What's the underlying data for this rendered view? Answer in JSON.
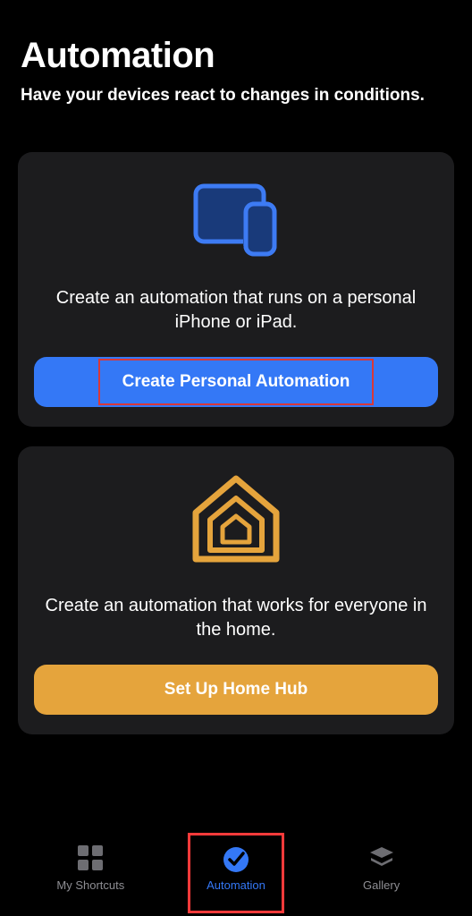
{
  "header": {
    "title": "Automation",
    "subtitle": "Have your devices react to changes in conditions."
  },
  "cards": {
    "personal": {
      "description": "Create an automation that runs on a personal iPhone or iPad.",
      "button_label": "Create Personal Automation"
    },
    "home": {
      "description": "Create an automation that works for everyone in the home.",
      "button_label": "Set Up Home Hub"
    }
  },
  "tabbar": {
    "shortcuts": {
      "label": "My Shortcuts"
    },
    "automation": {
      "label": "Automation"
    },
    "gallery": {
      "label": "Gallery"
    }
  }
}
